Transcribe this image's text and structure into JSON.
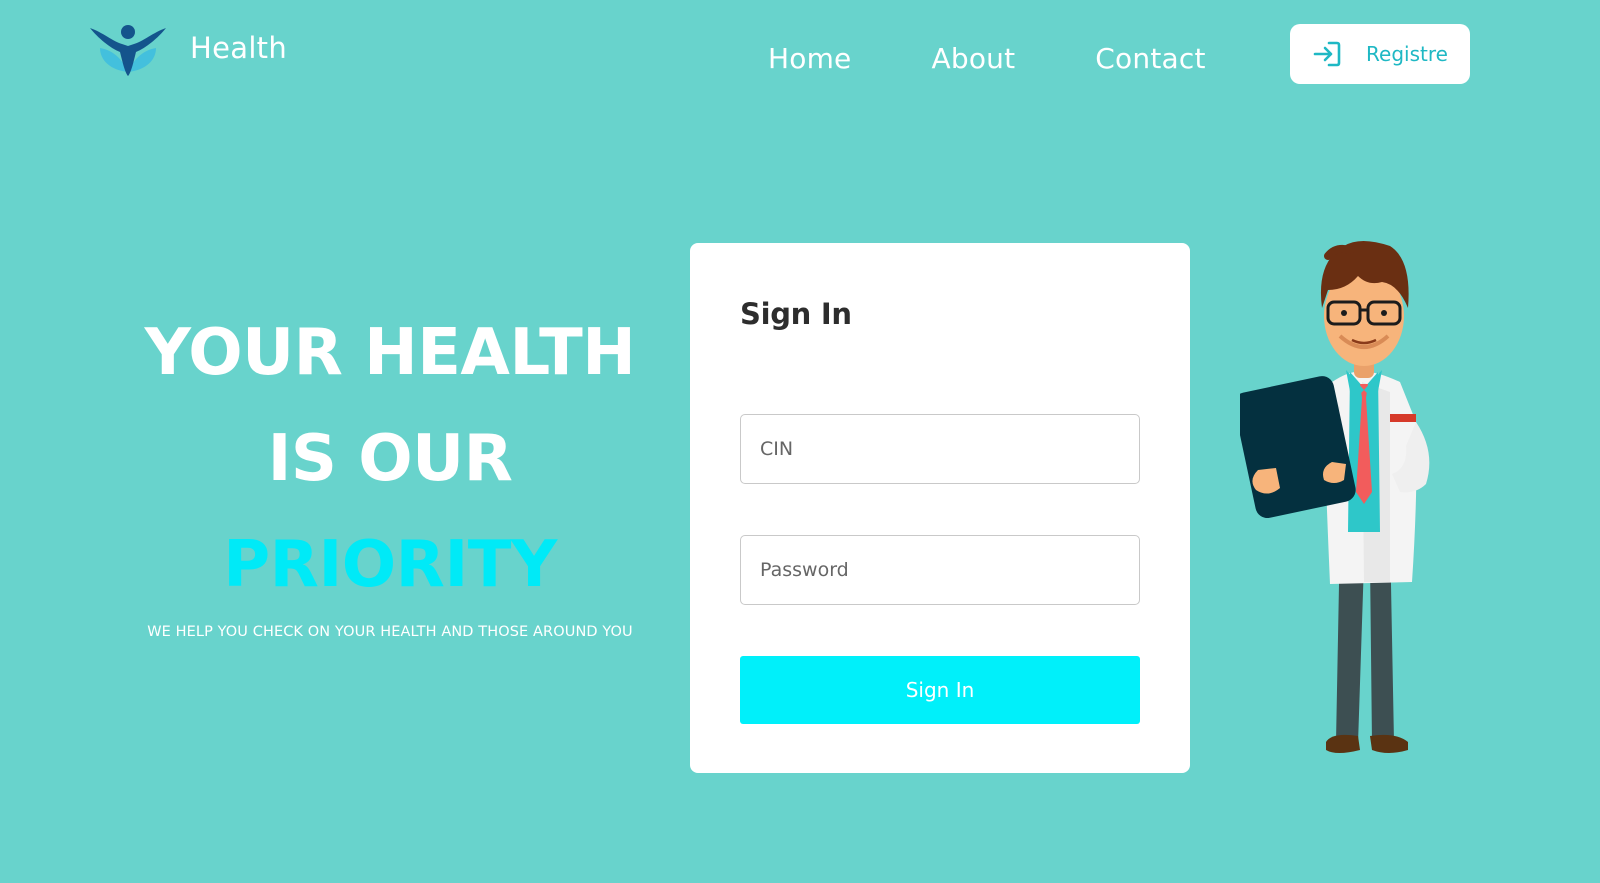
{
  "header": {
    "brand": "Health",
    "nav": [
      {
        "label": "Home"
      },
      {
        "label": "About"
      },
      {
        "label": "Contact"
      }
    ],
    "register_label": "Registre",
    "register_icon": "login-arrow-icon",
    "logo_icon": "person-leaf-logo"
  },
  "hero": {
    "line1": "YOUR HEALTH",
    "line2": "IS OUR",
    "line3": "PRIORITY",
    "tagline": "WE HELP YOU CHECK ON YOUR HEALTH AND THOSE AROUND YOU"
  },
  "signin": {
    "title": "Sign In",
    "cin_placeholder": "CIN",
    "password_placeholder": "Password",
    "submit_label": "Sign In"
  },
  "colors": {
    "background": "#68d3cc",
    "accent": "#00eaf7",
    "button": "#00f0fa",
    "register_text": "#1fb8c4"
  }
}
